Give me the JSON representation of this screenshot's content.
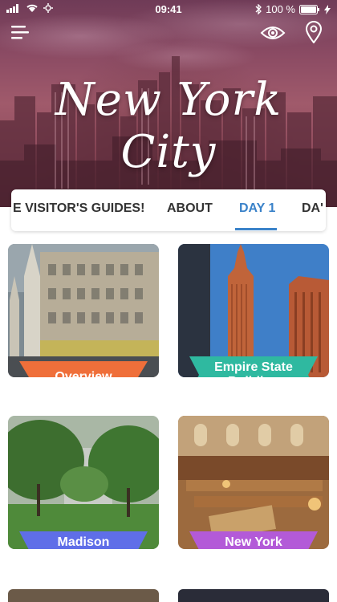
{
  "status_bar": {
    "time": "09:41",
    "battery": "100 %",
    "icons": [
      "signal-icon",
      "wifi-icon",
      "activity-icon",
      "bluetooth-icon",
      "battery-icon",
      "charging-icon"
    ]
  },
  "header": {
    "title": "New York City",
    "icons": [
      "menu-icon",
      "eye-icon",
      "location-pin-icon"
    ]
  },
  "tabs": [
    {
      "label": "E VISITOR'S GUIDES!"
    },
    {
      "label": "ABOUT"
    },
    {
      "label": "DAY 1",
      "active": true
    },
    {
      "label": "DA'"
    }
  ],
  "cards": [
    {
      "label": "Overview",
      "ribbon_color": "#ef6f3a"
    },
    {
      "label": "Empire State Building",
      "ribbon_color": "#2fb9a0"
    },
    {
      "label": "Madison Square",
      "ribbon_color": "#5f6ee8"
    },
    {
      "label": "New York Public Library",
      "ribbon_color": "#b35ad8"
    }
  ],
  "colors": {
    "accent": "#3a82c9",
    "tab_text": "#333333"
  }
}
